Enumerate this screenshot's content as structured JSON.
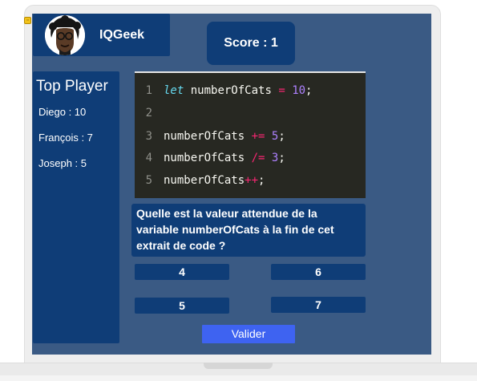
{
  "app": {
    "name": "IQGeek"
  },
  "score": {
    "label": "Score : 1"
  },
  "leaderboard": {
    "title": "Top Player",
    "players": [
      {
        "label": "Diego : 10"
      },
      {
        "label": "François : 7"
      },
      {
        "label": "Joseph : 5"
      }
    ]
  },
  "code": {
    "lines": [
      {
        "no": "1",
        "tokens": [
          {
            "t": "kw",
            "v": "let"
          },
          {
            "t": "id",
            "v": " numberOfCats "
          },
          {
            "t": "op",
            "v": "="
          },
          {
            "t": "id",
            "v": " "
          },
          {
            "t": "num",
            "v": "10"
          },
          {
            "t": "id",
            "v": ";"
          }
        ]
      },
      {
        "no": "2",
        "tokens": []
      },
      {
        "no": "3",
        "tokens": [
          {
            "t": "id",
            "v": "numberOfCats "
          },
          {
            "t": "op",
            "v": "+="
          },
          {
            "t": "id",
            "v": " "
          },
          {
            "t": "num",
            "v": "5"
          },
          {
            "t": "id",
            "v": ";"
          }
        ]
      },
      {
        "no": "4",
        "tokens": [
          {
            "t": "id",
            "v": "numberOfCats "
          },
          {
            "t": "op",
            "v": "/="
          },
          {
            "t": "id",
            "v": " "
          },
          {
            "t": "num",
            "v": "3"
          },
          {
            "t": "id",
            "v": ";"
          }
        ]
      },
      {
        "no": "5",
        "tokens": [
          {
            "t": "id",
            "v": "numberOfCats"
          },
          {
            "t": "op",
            "v": "++"
          },
          {
            "t": "id",
            "v": ";"
          }
        ]
      }
    ]
  },
  "question": {
    "text": "Quelle est la valeur attendue de la variable numberOfCats à la fin de cet extrait de code ?"
  },
  "answers": [
    {
      "label": "4"
    },
    {
      "label": "6"
    },
    {
      "label": "5"
    },
    {
      "label": "7"
    }
  ],
  "submit": {
    "label": "Valider"
  },
  "colors": {
    "screen_bg": "#3a5a84",
    "panel": "#0f3d77",
    "button": "#3e63f1",
    "code_bg": "#272822"
  },
  "icons": {
    "broken_image": "broken-image-icon"
  }
}
